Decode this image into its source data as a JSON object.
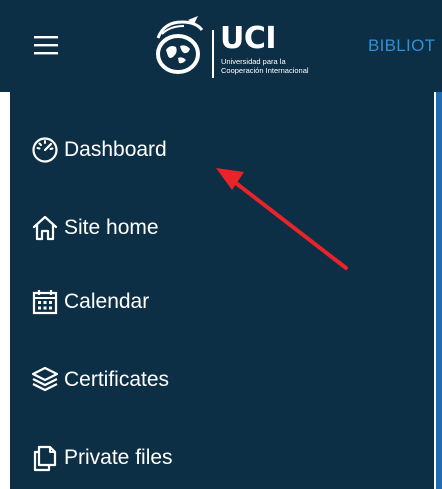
{
  "header": {
    "logo": {
      "brand": "UCI",
      "tagline_line1": "Universidad para la",
      "tagline_line2": "Cooperación Internacional"
    },
    "nav_link": "BIBLIOT",
    "icons": {
      "menu": "hamburger-menu-icon",
      "emblem": "uci-emblem-icon"
    }
  },
  "sidebar": {
    "items": [
      {
        "label": "Dashboard",
        "icon": "gauge-icon"
      },
      {
        "label": "Site home",
        "icon": "home-icon"
      },
      {
        "label": "Calendar",
        "icon": "calendar-icon"
      },
      {
        "label": "Certificates",
        "icon": "layers-icon"
      },
      {
        "label": "Private files",
        "icon": "files-icon"
      }
    ]
  },
  "annotation": {
    "color": "#e8232a",
    "points_to": "Dashboard"
  },
  "colors": {
    "background": "#0d2f45",
    "text": "#ffffff",
    "link": "#2f8fd8",
    "accent_strip": "#1b6fb8"
  }
}
